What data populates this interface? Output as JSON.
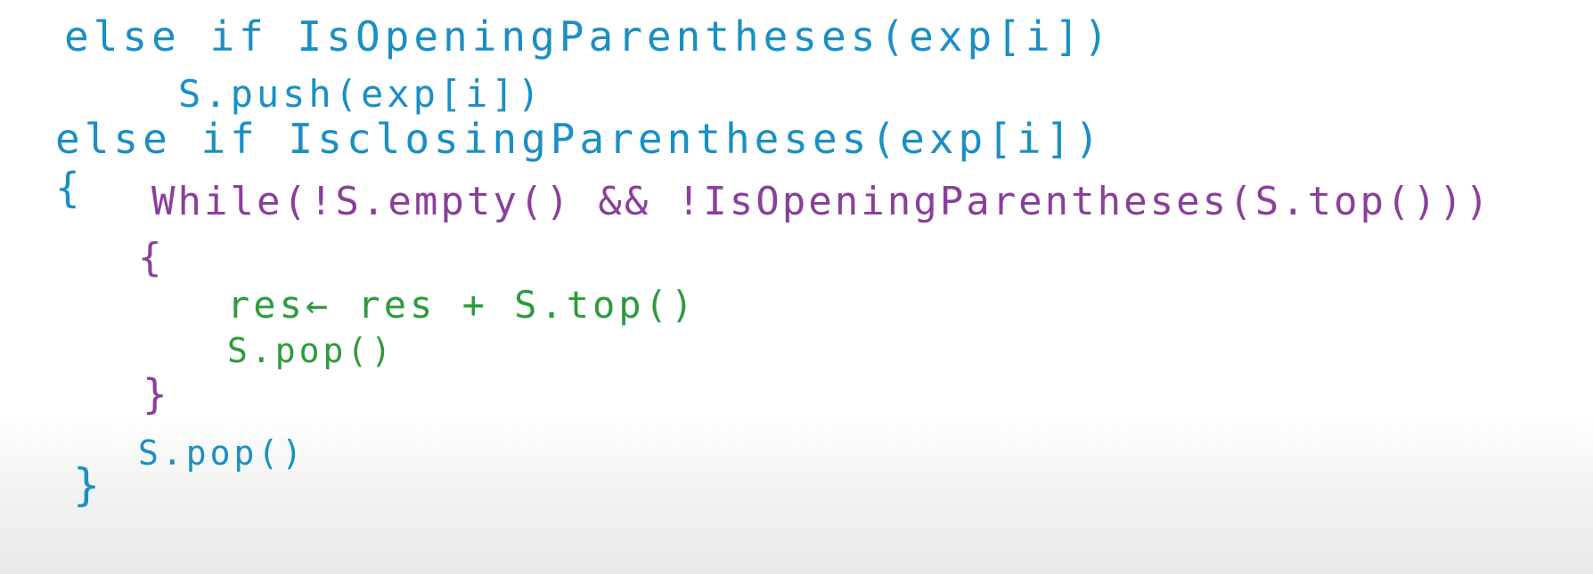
{
  "colors": {
    "blue": "#1a8fc3",
    "purple": "#8a3f9b",
    "green": "#2f9a3e",
    "background": "#ffffff"
  },
  "lines": [
    "else if IsOpeningParentheses(exp[i])",
    "S.push(exp[i])",
    "else if IsclosingParentheses(exp[i])",
    "{",
    "While(!S.empty() && !IsOpeningParentheses(S.top()))",
    "{",
    "res← res + S.top()",
    "S.pop()",
    "}",
    "S.pop()",
    "}"
  ]
}
